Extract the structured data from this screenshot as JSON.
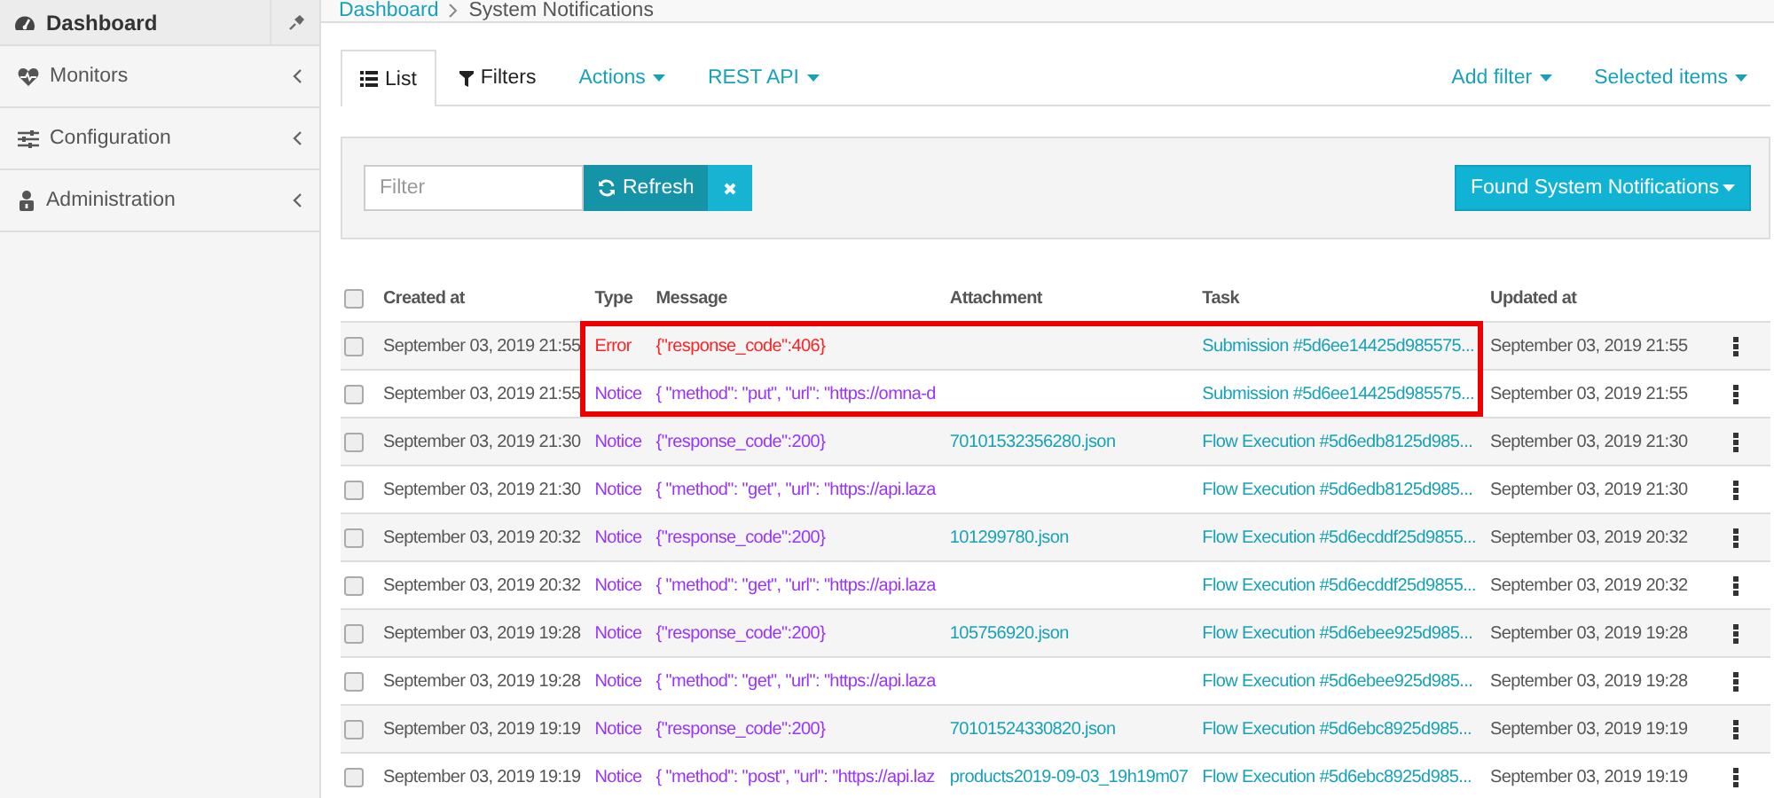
{
  "sidebar": {
    "title": "Dashboard",
    "items": [
      {
        "label": "Monitors"
      },
      {
        "label": "Configuration"
      },
      {
        "label": "Administration"
      }
    ]
  },
  "breadcrumb": {
    "link": "Dashboard",
    "current": "System Notifications"
  },
  "tabs": [
    {
      "label": "List",
      "kind": "view",
      "selected": true
    },
    {
      "label": "Filters",
      "kind": "view",
      "selected": false
    },
    {
      "label": "Actions",
      "kind": "menu",
      "selected": false
    },
    {
      "label": "REST API",
      "kind": "menu",
      "selected": false
    }
  ],
  "right_menus": [
    "Add filter",
    "Selected items"
  ],
  "filter_bar": {
    "placeholder": "Filter",
    "refresh": "Refresh",
    "found": "Found System Notifications"
  },
  "table": {
    "all_checked": false,
    "columns": [
      "Created at",
      "Type",
      "Message",
      "Attachment",
      "Task",
      "Updated at"
    ],
    "rows": [
      {
        "created": "September 03, 2019 21:55",
        "type": "Error",
        "kind": "error",
        "message": "{\"response_code\":406}",
        "attachment": "",
        "task": "Submission #5d6ee14425d985575...",
        "updated": "September 03, 2019 21:55",
        "highlighted": true,
        "checked": false
      },
      {
        "created": "September 03, 2019 21:55",
        "type": "Notice",
        "kind": "notice",
        "message": "{ \"method\": \"put\", \"url\": \"https://omna-d",
        "attachment": "",
        "task": "Submission #5d6ee14425d985575...",
        "updated": "September 03, 2019 21:55",
        "highlighted": true,
        "checked": false
      },
      {
        "created": "September 03, 2019 21:30",
        "type": "Notice",
        "kind": "notice",
        "message": "{\"response_code\":200}",
        "attachment": "70101532356280.json",
        "task": "Flow Execution #5d6edb8125d985...",
        "updated": "September 03, 2019 21:30",
        "highlighted": false,
        "checked": false
      },
      {
        "created": "September 03, 2019 21:30",
        "type": "Notice",
        "kind": "notice",
        "message": "{ \"method\": \"get\", \"url\": \"https://api.laza",
        "attachment": "",
        "task": "Flow Execution #5d6edb8125d985...",
        "updated": "September 03, 2019 21:30",
        "highlighted": false,
        "checked": false
      },
      {
        "created": "September 03, 2019 20:32",
        "type": "Notice",
        "kind": "notice",
        "message": "{\"response_code\":200}",
        "attachment": "101299780.json",
        "task": "Flow Execution #5d6ecddf25d9855...",
        "updated": "September 03, 2019 20:32",
        "highlighted": false,
        "checked": false
      },
      {
        "created": "September 03, 2019 20:32",
        "type": "Notice",
        "kind": "notice",
        "message": "{ \"method\": \"get\", \"url\": \"https://api.laza",
        "attachment": "",
        "task": "Flow Execution #5d6ecddf25d9855...",
        "updated": "September 03, 2019 20:32",
        "highlighted": false,
        "checked": false
      },
      {
        "created": "September 03, 2019 19:28",
        "type": "Notice",
        "kind": "notice",
        "message": "{\"response_code\":200}",
        "attachment": "105756920.json",
        "task": "Flow Execution #5d6ebee925d985...",
        "updated": "September 03, 2019 19:28",
        "highlighted": false,
        "checked": false
      },
      {
        "created": "September 03, 2019 19:28",
        "type": "Notice",
        "kind": "notice",
        "message": "{ \"method\": \"get\", \"url\": \"https://api.laza",
        "attachment": "",
        "task": "Flow Execution #5d6ebee925d985...",
        "updated": "September 03, 2019 19:28",
        "highlighted": false,
        "checked": false
      },
      {
        "created": "September 03, 2019 19:19",
        "type": "Notice",
        "kind": "notice",
        "message": "{\"response_code\":200}",
        "attachment": "70101524330820.json",
        "task": "Flow Execution #5d6ebc8925d985...",
        "updated": "September 03, 2019 19:19",
        "highlighted": false,
        "checked": false
      },
      {
        "created": "September 03, 2019 19:19",
        "type": "Notice",
        "kind": "notice",
        "message": "{ \"method\": \"post\", \"url\": \"https://api.laz",
        "attachment": "products2019-09-03_19h19m07",
        "task": "Flow Execution #5d6ebc8925d985...",
        "updated": "September 03, 2019 19:19",
        "highlighted": false,
        "checked": false
      }
    ]
  }
}
